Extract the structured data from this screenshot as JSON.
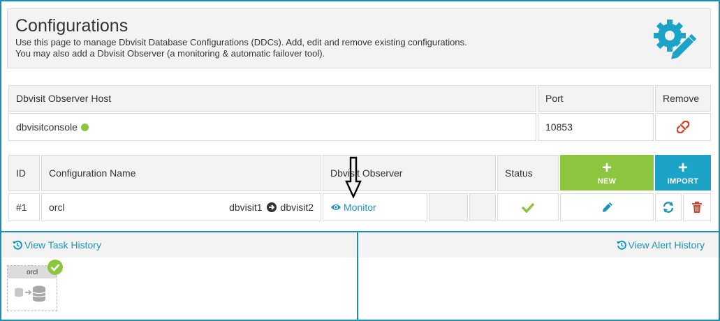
{
  "header": {
    "title": "Configurations",
    "desc_line1": "Use this page to manage Dbvisit Database Configurations (DDCs). Add, edit and remove existing configurations.",
    "desc_line2": "You may also add a Dbvisit Observer (a monitoring & automatic failover tool).",
    "icon": "gear-pencil-icon"
  },
  "observer_table": {
    "col_host": "Dbvisit Observer Host",
    "col_port": "Port",
    "col_remove": "Remove",
    "host": "dbvisitconsole",
    "port": "10853",
    "status_color": "#8cc63f"
  },
  "config_table": {
    "col_id": "ID",
    "col_name": "Configuration Name",
    "col_observer": "Dbvisit Observer",
    "col_status": "Status",
    "new_label": "NEW",
    "import_label": "IMPORT",
    "row": {
      "id": "#1",
      "name": "orcl",
      "primary": "dbvisit1",
      "standby": "dbvisit2",
      "monitor": "Monitor"
    }
  },
  "history": {
    "task_link": "View Task History",
    "alert_link": "View Alert History",
    "card_label": "orcl"
  },
  "colors": {
    "accent": "#1a8fb3",
    "green": "#8cc63f",
    "blue": "#1ba4c8",
    "red": "#d9452b"
  }
}
